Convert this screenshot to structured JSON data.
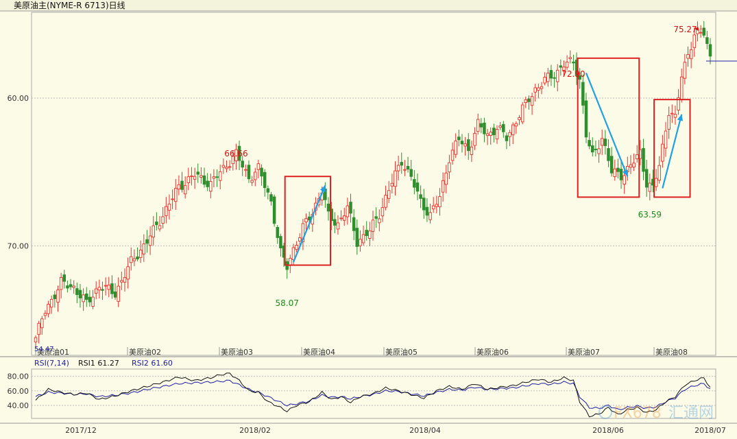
{
  "title": "美原油主(NYME-R 6713)日线",
  "colors": {
    "background": "#fbfbe7",
    "up": "#e8302a",
    "down": "#2f8f2f",
    "grid": "#bdbdbd",
    "annotation_box": "#dd2020",
    "arrow": "#1fa0e6",
    "rsi1": "#111111",
    "rsi2": "#1c1ca0",
    "price_label": "#333333",
    "high_label": "#d01010",
    "low_label": "#1a8a1a"
  },
  "price_axis": {
    "ticks": [
      "70.00",
      "60.00"
    ]
  },
  "contract_labels": [
    "美原油01",
    "美原油02",
    "美原油03",
    "美原油04",
    "美原油05",
    "美原油06",
    "美原油07",
    "美原油08"
  ],
  "last_price_tag": "54.47",
  "rsi_panel": {
    "header": "RSI(7,14)",
    "rsi1_label": "RSI1 61.27",
    "rsi2_label": "RSI2 61.60",
    "ticks": [
      "80.00",
      "60.00",
      "40.00"
    ]
  },
  "date_axis": [
    "2017/12",
    "2018/02",
    "2018/04",
    "2018/06",
    "2018/07"
  ],
  "watermark": {
    "text_latin": "FX678",
    "text_cn": "汇通网"
  },
  "chart_data": [
    {
      "type": "candlestick",
      "title": "美原油主(NYME-R 6713)日线",
      "ylim": [
        52.6,
        75.8
      ],
      "yticks": [
        60,
        70
      ],
      "annotations": {
        "high_1": "66.66",
        "low_1": "58.07",
        "high_2": "72.90",
        "low_2": "63.59",
        "high_3": "75.27"
      },
      "highlight_boxes": 3,
      "trend_arrows": [
        "up",
        "down",
        "up"
      ],
      "close_waypoints": [
        [
          0,
          53.8
        ],
        [
          3,
          55.6
        ],
        [
          8,
          57.5
        ],
        [
          12,
          57.2
        ],
        [
          16,
          56.1
        ],
        [
          20,
          57.3
        ],
        [
          25,
          56.8
        ],
        [
          30,
          58.9
        ],
        [
          35,
          60.3
        ],
        [
          40,
          62.1
        ],
        [
          45,
          64.0
        ],
        [
          50,
          64.8
        ],
        [
          55,
          64.2
        ],
        [
          60,
          65.5
        ],
        [
          63,
          66.2
        ],
        [
          67,
          64.6
        ],
        [
          70,
          65.2
        ],
        [
          74,
          63.0
        ],
        [
          77,
          59.5
        ],
        [
          79,
          58.6
        ],
        [
          81,
          59.8
        ],
        [
          84,
          61.2
        ],
        [
          87,
          62.3
        ],
        [
          90,
          63.8
        ],
        [
          92,
          62.0
        ],
        [
          95,
          61.5
        ],
        [
          98,
          62.6
        ],
        [
          101,
          60.3
        ],
        [
          105,
          61.0
        ],
        [
          108,
          62.2
        ],
        [
          112,
          64.3
        ],
        [
          115,
          65.8
        ],
        [
          118,
          64.6
        ],
        [
          121,
          63.0
        ],
        [
          124,
          62.1
        ],
        [
          127,
          63.3
        ],
        [
          130,
          66.0
        ],
        [
          133,
          67.2
        ],
        [
          136,
          66.5
        ],
        [
          139,
          68.2
        ],
        [
          142,
          67.5
        ],
        [
          145,
          68.0
        ],
        [
          148,
          67.3
        ],
        [
          151,
          68.5
        ],
        [
          154,
          69.6
        ],
        [
          157,
          70.6
        ],
        [
          160,
          71.2
        ],
        [
          163,
          71.6
        ],
        [
          166,
          72.3
        ],
        [
          169,
          72.4
        ],
        [
          171,
          71.3
        ],
        [
          173,
          67.5
        ],
        [
          175,
          66.0
        ],
        [
          178,
          67.4
        ],
        [
          181,
          65.0
        ],
        [
          184,
          64.8
        ],
        [
          187,
          65.4
        ],
        [
          190,
          66.3
        ],
        [
          192,
          64.3
        ],
        [
          194,
          63.9
        ],
        [
          196,
          65.4
        ],
        [
          199,
          69.2
        ],
        [
          201,
          68.6
        ],
        [
          203,
          71.5
        ],
        [
          205,
          73.0
        ],
        [
          207,
          74.3
        ],
        [
          210,
          74.4
        ],
        [
          212,
          72.8
        ]
      ],
      "rsi_waypoints": {
        "rsi1": [
          [
            0,
            47
          ],
          [
            4,
            62
          ],
          [
            8,
            58
          ],
          [
            12,
            55
          ],
          [
            16,
            57
          ],
          [
            20,
            48
          ],
          [
            25,
            53
          ],
          [
            30,
            60
          ],
          [
            35,
            66
          ],
          [
            40,
            72
          ],
          [
            45,
            79
          ],
          [
            50,
            74
          ],
          [
            55,
            78
          ],
          [
            58,
            82
          ],
          [
            61,
            84
          ],
          [
            64,
            74
          ],
          [
            67,
            60
          ],
          [
            70,
            58
          ],
          [
            73,
            45
          ],
          [
            76,
            39
          ],
          [
            79,
            32
          ],
          [
            82,
            40
          ],
          [
            86,
            45
          ],
          [
            90,
            58
          ],
          [
            93,
            48
          ],
          [
            96,
            52
          ],
          [
            99,
            44
          ],
          [
            102,
            52
          ],
          [
            106,
            56
          ],
          [
            110,
            64
          ],
          [
            114,
            60
          ],
          [
            118,
            55
          ],
          [
            122,
            50
          ],
          [
            126,
            60
          ],
          [
            130,
            66
          ],
          [
            134,
            62
          ],
          [
            138,
            70
          ],
          [
            142,
            62
          ],
          [
            146,
            65
          ],
          [
            150,
            67
          ],
          [
            154,
            72
          ],
          [
            158,
            76
          ],
          [
            162,
            72
          ],
          [
            166,
            78
          ],
          [
            169,
            74
          ],
          [
            171,
            45
          ],
          [
            174,
            25
          ],
          [
            177,
            28
          ],
          [
            180,
            37
          ],
          [
            183,
            27
          ],
          [
            186,
            34
          ],
          [
            189,
            37
          ],
          [
            192,
            30
          ],
          [
            195,
            34
          ],
          [
            198,
            45
          ],
          [
            201,
            52
          ],
          [
            204,
            68
          ],
          [
            207,
            74
          ],
          [
            210,
            78
          ],
          [
            212,
            64
          ]
        ],
        "rsi2": [
          [
            0,
            52
          ],
          [
            4,
            58
          ],
          [
            8,
            57
          ],
          [
            12,
            55
          ],
          [
            16,
            56
          ],
          [
            20,
            52
          ],
          [
            25,
            54
          ],
          [
            30,
            57
          ],
          [
            35,
            62
          ],
          [
            40,
            66
          ],
          [
            45,
            70
          ],
          [
            50,
            71
          ],
          [
            55,
            72
          ],
          [
            58,
            73
          ],
          [
            61,
            74
          ],
          [
            64,
            68
          ],
          [
            67,
            62
          ],
          [
            70,
            58
          ],
          [
            73,
            52
          ],
          [
            76,
            46
          ],
          [
            79,
            40
          ],
          [
            82,
            42
          ],
          [
            86,
            46
          ],
          [
            90,
            54
          ],
          [
            93,
            51
          ],
          [
            96,
            52
          ],
          [
            99,
            49
          ],
          [
            102,
            52
          ],
          [
            106,
            55
          ],
          [
            110,
            60
          ],
          [
            114,
            59
          ],
          [
            118,
            56
          ],
          [
            122,
            53
          ],
          [
            126,
            58
          ],
          [
            130,
            62
          ],
          [
            134,
            61
          ],
          [
            138,
            65
          ],
          [
            142,
            62
          ],
          [
            146,
            63
          ],
          [
            150,
            64
          ],
          [
            154,
            67
          ],
          [
            158,
            70
          ],
          [
            162,
            69
          ],
          [
            166,
            72
          ],
          [
            169,
            70
          ],
          [
            171,
            52
          ],
          [
            174,
            37
          ],
          [
            177,
            36
          ],
          [
            180,
            40
          ],
          [
            183,
            34
          ],
          [
            186,
            37
          ],
          [
            189,
            39
          ],
          [
            192,
            36
          ],
          [
            195,
            38
          ],
          [
            198,
            45
          ],
          [
            201,
            50
          ],
          [
            204,
            62
          ],
          [
            207,
            67
          ],
          [
            210,
            70
          ],
          [
            212,
            62
          ]
        ]
      },
      "rsi_ylim": [
        22,
        90
      ]
    }
  ]
}
